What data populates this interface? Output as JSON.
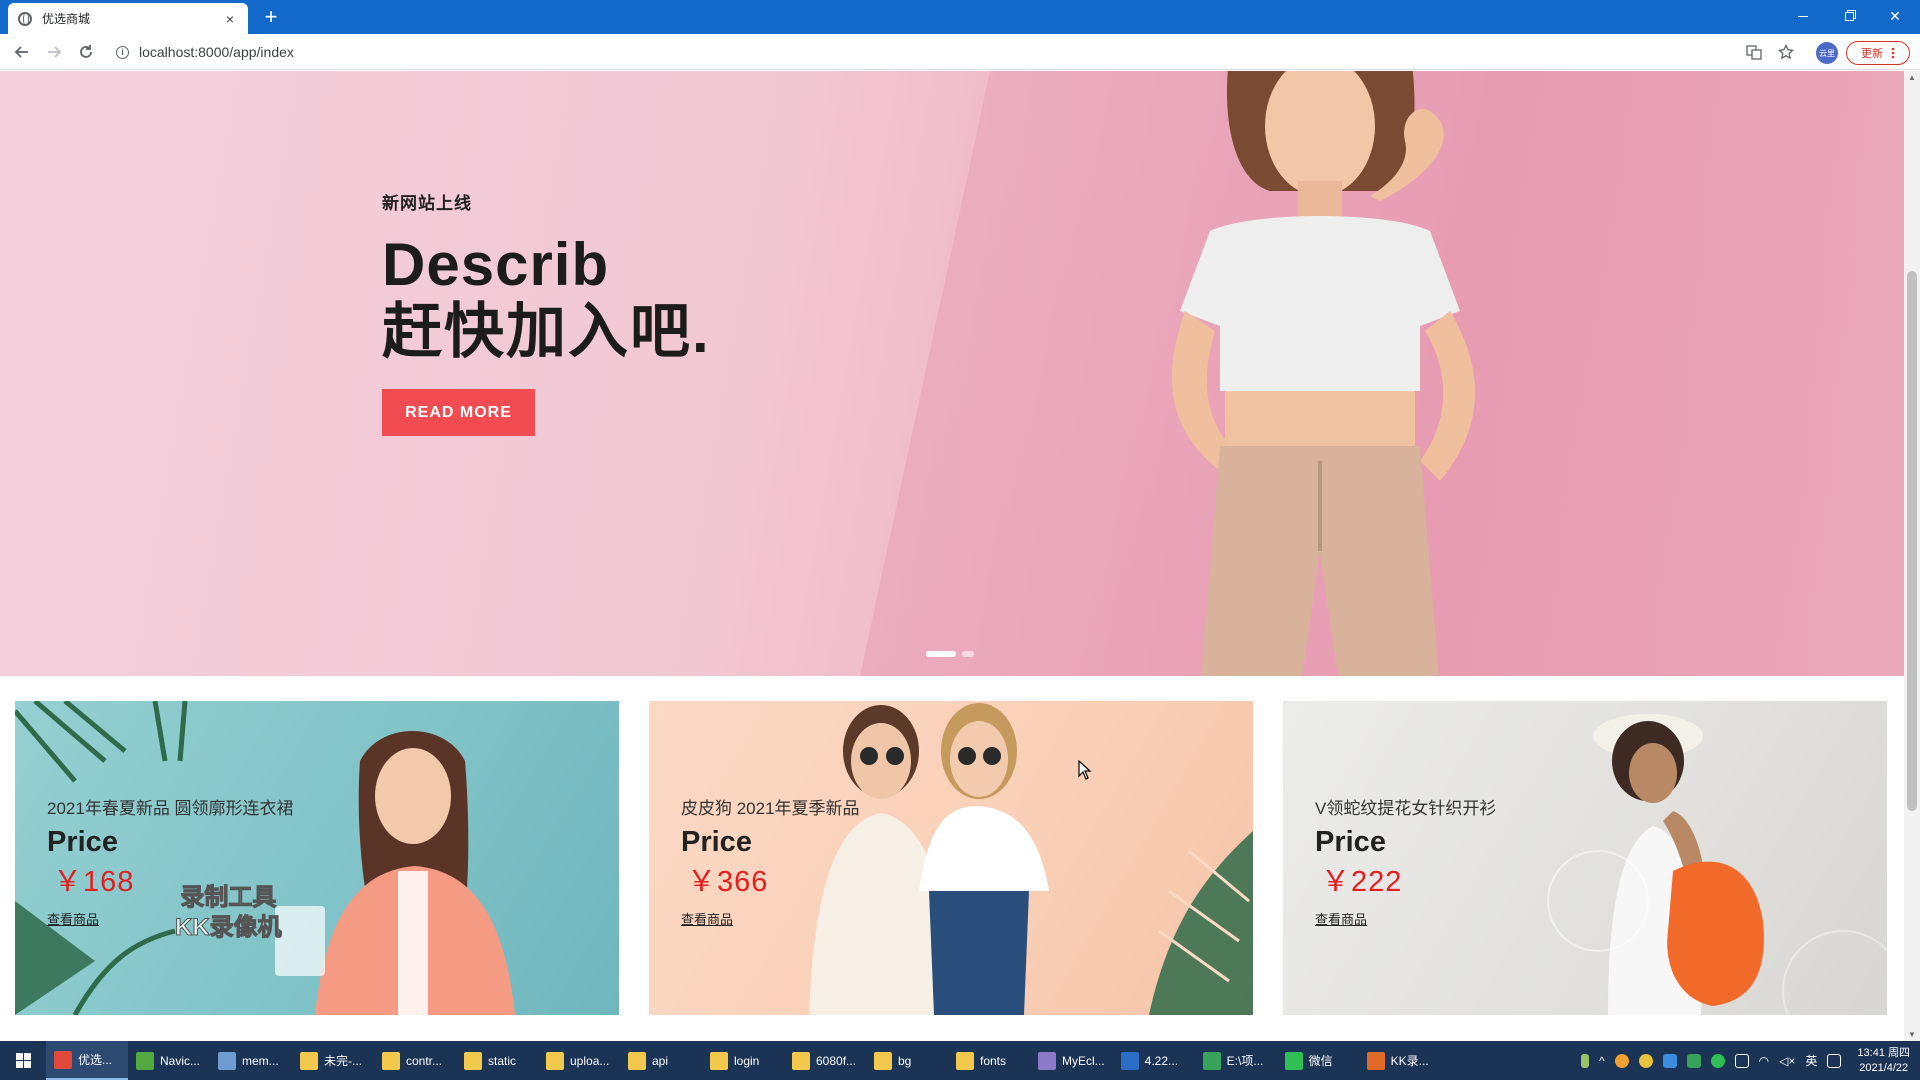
{
  "browser": {
    "tab_title": "优选商城",
    "tab_close": "×",
    "new_tab": "+",
    "url": "localhost:8000/app/index",
    "update_label": "更新",
    "profile_label": "云里",
    "window_close": "✕"
  },
  "hero": {
    "subtitle": "新网站上线",
    "title_line1": "Describ",
    "title_line2": "赶快加入吧.",
    "cta_label": "READ MORE",
    "slides_total": 2,
    "active_slide": 1
  },
  "banners": [
    {
      "name": "2021年春夏新品 圆领廓形连衣裙",
      "price_label": "Price",
      "price": "￥168",
      "link": "查看商品"
    },
    {
      "name": "皮皮狗 2021年夏季新品",
      "price_label": "Price",
      "price": "￥366",
      "link": "查看商品"
    },
    {
      "name": "V领蛇纹提花女针织开衫",
      "price_label": "Price",
      "price": "￥222",
      "link": "查看商品"
    }
  ],
  "watermark": {
    "line1": "录制工具",
    "line2": "KK录像机"
  },
  "taskbar": {
    "items": [
      {
        "label": "优选...",
        "color": "#e0483c"
      },
      {
        "label": "Navic...",
        "color": "#53a93f"
      },
      {
        "label": "mem...",
        "color": "#6f9bd1"
      },
      {
        "label": "未完-...",
        "color": "#f2c94c"
      },
      {
        "label": "contr...",
        "color": "#f2c94c"
      },
      {
        "label": "static",
        "color": "#f2c94c"
      },
      {
        "label": "uploa...",
        "color": "#f2c94c"
      },
      {
        "label": "api",
        "color": "#f2c94c"
      },
      {
        "label": "login",
        "color": "#f2c94c"
      },
      {
        "label": "6080f...",
        "color": "#f2c94c"
      },
      {
        "label": "bg",
        "color": "#f2c94c"
      },
      {
        "label": "fonts",
        "color": "#f2c94c"
      },
      {
        "label": "MyEcl...",
        "color": "#8b7ac7"
      },
      {
        "label": "4.22...",
        "color": "#2b6cc4"
      },
      {
        "label": "E:\\项...",
        "color": "#3aa35b"
      },
      {
        "label": "微信",
        "color": "#2fbf55"
      },
      {
        "label": "KK录...",
        "color": "#e06a2a"
      }
    ],
    "ime": "英",
    "time": "13:41 周四",
    "date": "2021/4/22"
  },
  "colors": {
    "chrome_blue": "#1369c9",
    "cta_red": "#f24b52",
    "price_red": "#e21e1e"
  }
}
